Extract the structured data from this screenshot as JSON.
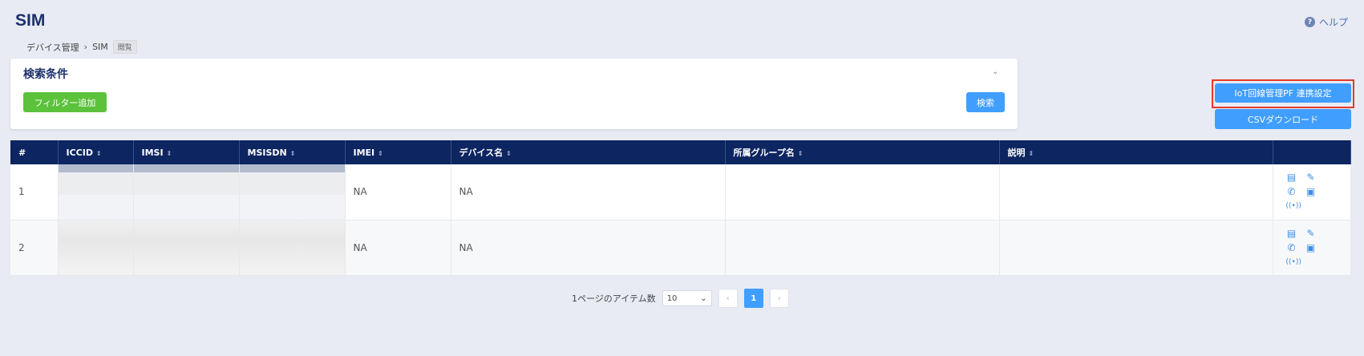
{
  "header": {
    "title": "SIM",
    "help_label": "ヘルプ"
  },
  "breadcrumb": {
    "items": [
      "デバイス管理",
      "SIM"
    ],
    "badge": "閲覧"
  },
  "search": {
    "title": "検索条件",
    "add_filter": "フィルター追加",
    "search_button": "検索"
  },
  "actions": {
    "iot_settings": "IoT回線管理PF 連携設定",
    "csv_download": "CSVダウンロード"
  },
  "table": {
    "columns": [
      "#",
      "ICCID",
      "IMSI",
      "MSISDN",
      "IMEI",
      "デバイス名",
      "所属グループ名",
      "説明",
      ""
    ],
    "rows": [
      {
        "index": "1",
        "imei": "NA",
        "device_name": "NA",
        "group": "",
        "description": ""
      },
      {
        "index": "2",
        "imei": "NA",
        "device_name": "NA",
        "group": "",
        "description": ""
      }
    ]
  },
  "pagination": {
    "items_per_page_label": "1ページのアイテム数",
    "page_size": "10",
    "current_page": "1",
    "prev_icon": "‹",
    "next_icon": "›"
  },
  "icons": [
    "help-icon",
    "chevron-right-icon",
    "chevron-down-icon",
    "sort-icon",
    "document-icon",
    "edit-icon",
    "phone-signal-icon",
    "terminal-icon",
    "wireless-icon"
  ]
}
